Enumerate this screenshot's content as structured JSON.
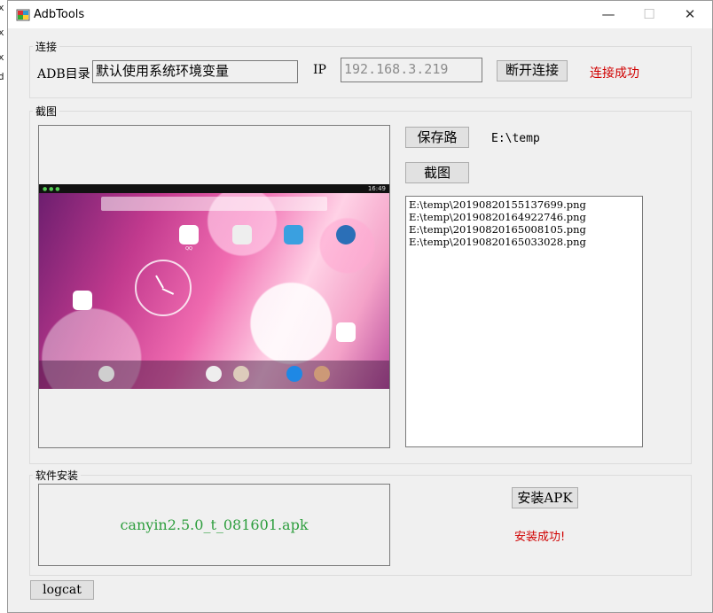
{
  "window": {
    "title": "AdbTools",
    "minimize": "—",
    "maximize": "☐",
    "close": "✕"
  },
  "left_clip": [
    "x",
    "x",
    "x",
    "d"
  ],
  "connect": {
    "group_label": "连接",
    "adb_label": "ADB目录",
    "adb_value": "默认使用系统环境变量",
    "ip_label": "IP",
    "ip_value": "192.168.3.219",
    "disconnect_button": "断开连接",
    "status": "连接成功"
  },
  "screenshot": {
    "group_label": "截图",
    "save_path_button": "保存路",
    "save_path_value": "E:\\temp",
    "capture_button": "截图",
    "device_time": "16:49",
    "files": [
      "E:\\temp\\20190820155137699.png",
      "E:\\temp\\20190820164922746.png",
      "E:\\temp\\20190820165008105.png",
      "E:\\temp\\20190820165033028.png"
    ]
  },
  "install": {
    "group_label": "软件安装",
    "apk_file": "canyin2.5.0_t_081601.apk",
    "install_button": "安装APK",
    "status": "安装成功!"
  },
  "logcat_button": "logcat",
  "colors": {
    "status_red": "#d00000",
    "apk_green": "#2e9e3e",
    "window_bg": "#f0f0f0"
  }
}
